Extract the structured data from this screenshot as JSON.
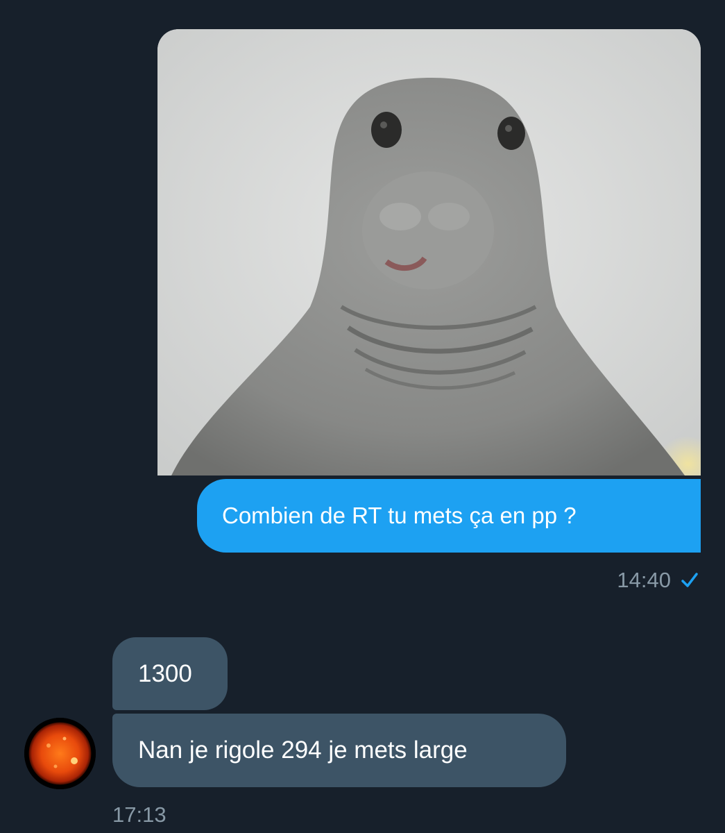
{
  "conversation": {
    "sent_message": {
      "media_icon": "seal-meme-image",
      "text": "Combien de RT tu mets ça en pp ?",
      "time": "14:40",
      "status_icon": "check-icon"
    },
    "received_messages": [
      {
        "text": "1300"
      },
      {
        "text": "Nan je rigole 294 je mets large"
      }
    ],
    "received_time": "17:13",
    "avatar_icon": "sun-avatar"
  },
  "colors": {
    "background": "#17202b",
    "sent_bubble": "#1da1f2",
    "received_bubble": "#3d5466",
    "meta_text": "#8899a6",
    "check": "#1da1f2"
  }
}
